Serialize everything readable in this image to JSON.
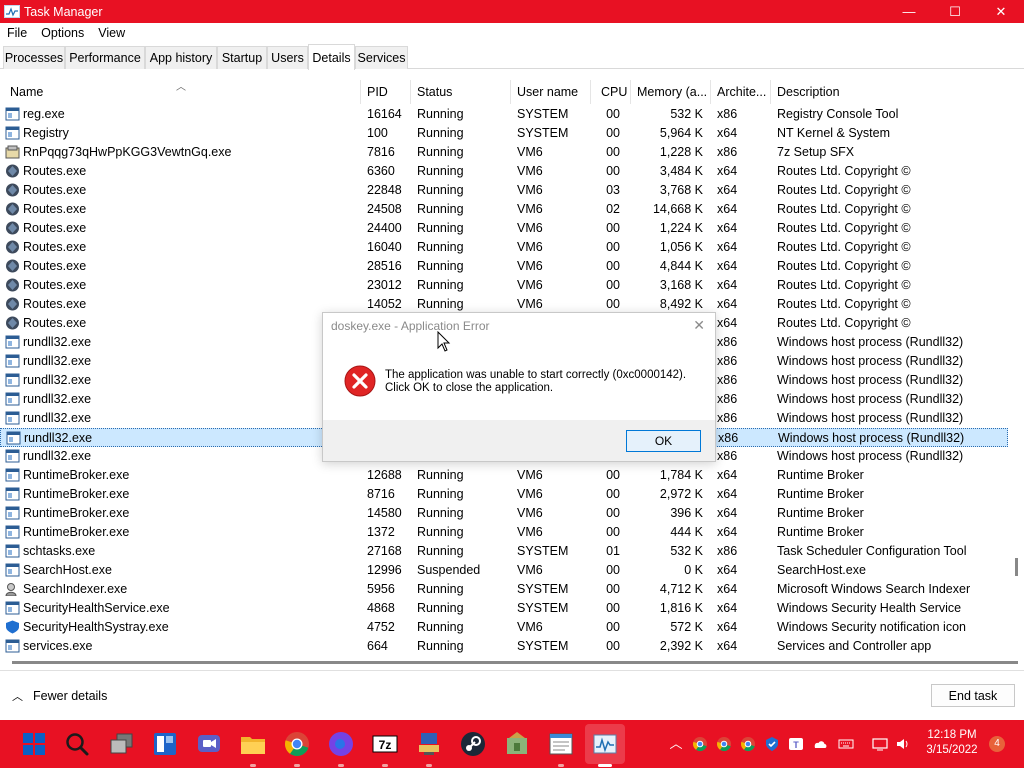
{
  "window": {
    "title": "Task Manager",
    "controls": {
      "minimize": "—",
      "maximize": "☐",
      "close": "✕"
    }
  },
  "menu": [
    "File",
    "Options",
    "View"
  ],
  "tabs": [
    "Processes",
    "Performance",
    "App history",
    "Startup",
    "Users",
    "Details",
    "Services"
  ],
  "active_tab": "Details",
  "columns": [
    "Name",
    "PID",
    "Status",
    "User name",
    "CPU",
    "Memory (a...",
    "Archite...",
    "Description"
  ],
  "rows": [
    {
      "icon": "window-icon",
      "name": "reg.exe",
      "pid": "16164",
      "status": "Running",
      "user": "SYSTEM",
      "cpu": "00",
      "memory": "532 K",
      "arch": "x86",
      "desc": "Registry Console Tool"
    },
    {
      "icon": "window-icon",
      "name": "Registry",
      "pid": "100",
      "status": "Running",
      "user": "SYSTEM",
      "cpu": "00",
      "memory": "5,964 K",
      "arch": "x64",
      "desc": "NT Kernel & System"
    },
    {
      "icon": "setup-icon",
      "name": "RnPqqg73qHwPpKGG3VewtnGq.exe",
      "pid": "7816",
      "status": "Running",
      "user": "VM6",
      "cpu": "00",
      "memory": "1,228 K",
      "arch": "x86",
      "desc": "7z Setup SFX"
    },
    {
      "icon": "routes-icon",
      "name": "Routes.exe",
      "pid": "6360",
      "status": "Running",
      "user": "VM6",
      "cpu": "00",
      "memory": "3,484 K",
      "arch": "x64",
      "desc": "Routes Ltd. Copyright ©"
    },
    {
      "icon": "routes-icon",
      "name": "Routes.exe",
      "pid": "22848",
      "status": "Running",
      "user": "VM6",
      "cpu": "03",
      "memory": "3,768 K",
      "arch": "x64",
      "desc": "Routes Ltd. Copyright ©"
    },
    {
      "icon": "routes-icon",
      "name": "Routes.exe",
      "pid": "24508",
      "status": "Running",
      "user": "VM6",
      "cpu": "02",
      "memory": "14,668 K",
      "arch": "x64",
      "desc": "Routes Ltd. Copyright ©"
    },
    {
      "icon": "routes-icon",
      "name": "Routes.exe",
      "pid": "24400",
      "status": "Running",
      "user": "VM6",
      "cpu": "00",
      "memory": "1,224 K",
      "arch": "x64",
      "desc": "Routes Ltd. Copyright ©"
    },
    {
      "icon": "routes-icon",
      "name": "Routes.exe",
      "pid": "16040",
      "status": "Running",
      "user": "VM6",
      "cpu": "00",
      "memory": "1,056 K",
      "arch": "x64",
      "desc": "Routes Ltd. Copyright ©"
    },
    {
      "icon": "routes-icon",
      "name": "Routes.exe",
      "pid": "28516",
      "status": "Running",
      "user": "VM6",
      "cpu": "00",
      "memory": "4,844 K",
      "arch": "x64",
      "desc": "Routes Ltd. Copyright ©"
    },
    {
      "icon": "routes-icon",
      "name": "Routes.exe",
      "pid": "23012",
      "status": "Running",
      "user": "VM6",
      "cpu": "00",
      "memory": "3,168 K",
      "arch": "x64",
      "desc": "Routes Ltd. Copyright ©"
    },
    {
      "icon": "routes-icon",
      "name": "Routes.exe",
      "pid": "14052",
      "status": "Running",
      "user": "VM6",
      "cpu": "00",
      "memory": "8,492 K",
      "arch": "x64",
      "desc": "Routes Ltd. Copyright ©"
    },
    {
      "icon": "routes-icon",
      "name": "Routes.exe",
      "pid": "",
      "status": "",
      "user": "",
      "cpu": "",
      "memory": "",
      "arch": "x64",
      "desc": "Routes Ltd. Copyright ©"
    },
    {
      "icon": "window-icon",
      "name": "rundll32.exe",
      "pid": "",
      "status": "",
      "user": "",
      "cpu": "",
      "memory": "",
      "arch": "x86",
      "desc": "Windows host process (Rundll32)"
    },
    {
      "icon": "window-icon",
      "name": "rundll32.exe",
      "pid": "",
      "status": "",
      "user": "",
      "cpu": "",
      "memory": "",
      "arch": "x86",
      "desc": "Windows host process (Rundll32)"
    },
    {
      "icon": "window-icon",
      "name": "rundll32.exe",
      "pid": "",
      "status": "",
      "user": "",
      "cpu": "",
      "memory": "",
      "arch": "x86",
      "desc": "Windows host process (Rundll32)"
    },
    {
      "icon": "window-icon",
      "name": "rundll32.exe",
      "pid": "",
      "status": "",
      "user": "",
      "cpu": "",
      "memory": "",
      "arch": "x86",
      "desc": "Windows host process (Rundll32)"
    },
    {
      "icon": "window-icon",
      "name": "rundll32.exe",
      "pid": "",
      "status": "",
      "user": "",
      "cpu": "",
      "memory": "",
      "arch": "x86",
      "desc": "Windows host process (Rundll32)"
    },
    {
      "icon": "window-icon",
      "name": "rundll32.exe",
      "pid": "",
      "status": "",
      "user": "",
      "cpu": "",
      "memory": "",
      "arch": "x86",
      "desc": "Windows host process (Rundll32)",
      "selected": true
    },
    {
      "icon": "window-icon",
      "name": "rundll32.exe",
      "pid": "",
      "status": "",
      "user": "",
      "cpu": "",
      "memory": "",
      "arch": "x86",
      "desc": "Windows host process (Rundll32)"
    },
    {
      "icon": "window-icon",
      "name": "RuntimeBroker.exe",
      "pid": "12688",
      "status": "Running",
      "user": "VM6",
      "cpu": "00",
      "memory": "1,784 K",
      "arch": "x64",
      "desc": "Runtime Broker"
    },
    {
      "icon": "window-icon",
      "name": "RuntimeBroker.exe",
      "pid": "8716",
      "status": "Running",
      "user": "VM6",
      "cpu": "00",
      "memory": "2,972 K",
      "arch": "x64",
      "desc": "Runtime Broker"
    },
    {
      "icon": "window-icon",
      "name": "RuntimeBroker.exe",
      "pid": "14580",
      "status": "Running",
      "user": "VM6",
      "cpu": "00",
      "memory": "396 K",
      "arch": "x64",
      "desc": "Runtime Broker"
    },
    {
      "icon": "window-icon",
      "name": "RuntimeBroker.exe",
      "pid": "1372",
      "status": "Running",
      "user": "VM6",
      "cpu": "00",
      "memory": "444 K",
      "arch": "x64",
      "desc": "Runtime Broker"
    },
    {
      "icon": "window-icon",
      "name": "schtasks.exe",
      "pid": "27168",
      "status": "Running",
      "user": "SYSTEM",
      "cpu": "01",
      "memory": "532 K",
      "arch": "x86",
      "desc": "Task Scheduler Configuration Tool"
    },
    {
      "icon": "window-icon",
      "name": "SearchHost.exe",
      "pid": "12996",
      "status": "Suspended",
      "user": "VM6",
      "cpu": "00",
      "memory": "0 K",
      "arch": "x64",
      "desc": "SearchHost.exe"
    },
    {
      "icon": "search-indexer-icon",
      "name": "SearchIndexer.exe",
      "pid": "5956",
      "status": "Running",
      "user": "SYSTEM",
      "cpu": "00",
      "memory": "4,712 K",
      "arch": "x64",
      "desc": "Microsoft Windows Search Indexer"
    },
    {
      "icon": "window-icon",
      "name": "SecurityHealthService.exe",
      "pid": "4868",
      "status": "Running",
      "user": "SYSTEM",
      "cpu": "00",
      "memory": "1,816 K",
      "arch": "x64",
      "desc": "Windows Security Health Service"
    },
    {
      "icon": "shield-icon",
      "name": "SecurityHealthSystray.exe",
      "pid": "4752",
      "status": "Running",
      "user": "VM6",
      "cpu": "00",
      "memory": "572 K",
      "arch": "x64",
      "desc": "Windows Security notification icon"
    },
    {
      "icon": "window-icon",
      "name": "services.exe",
      "pid": "664",
      "status": "Running",
      "user": "SYSTEM",
      "cpu": "00",
      "memory": "2,392 K",
      "arch": "x64",
      "desc": "Services and Controller app"
    }
  ],
  "footer": {
    "fewer_details": "Fewer details",
    "end_task": "End task"
  },
  "dialog": {
    "title": "doskey.exe - Application Error",
    "close": "✕",
    "message_line1": "The application was unable to start correctly (0xc0000142).",
    "message_line2": "Click OK to close the application.",
    "ok": "OK"
  },
  "taskbar": {
    "apps": [
      "start-icon",
      "search-icon",
      "task-view-icon",
      "widgets-icon",
      "teams-chat-icon",
      "file-explorer-icon",
      "chrome-icon",
      "firefox-icon",
      "7zip-icon",
      "network-app-icon",
      "steam-icon",
      "tool-icon",
      "notepad-icon",
      "task-manager-icon"
    ],
    "tray": [
      "chevron-up-icon",
      "chrome-tray-icon",
      "chrome-tray-icon",
      "chrome-tray-icon",
      "security-icon",
      "teams-tray-icon",
      "onedrive-icon",
      "keyboard-icon",
      "display-icon",
      "volume-icon"
    ],
    "time": "12:18 PM",
    "date": "3/15/2022",
    "notifications": "4"
  },
  "colors": {
    "accent": "#e81123",
    "selection": "#cce8ff",
    "dialog_footer": "#f0f0f0"
  }
}
